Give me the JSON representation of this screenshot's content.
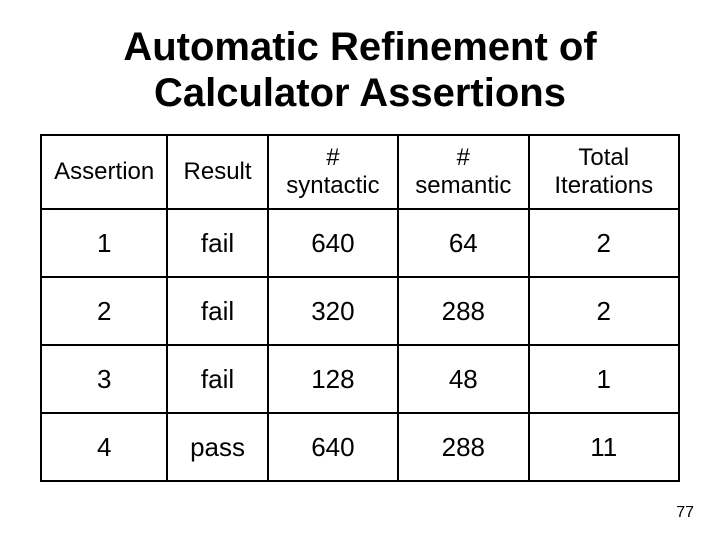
{
  "title": "Automatic Refinement of Calculator Assertions",
  "headers": {
    "c1": "Assertion",
    "c2": "Result",
    "c3a": "#",
    "c3b": "syntactic",
    "c4a": "#",
    "c4b": "semantic",
    "c5a": "Total",
    "c5b": "Iterations"
  },
  "rows": [
    {
      "assertion": "1",
      "result": "fail",
      "syntactic": "640",
      "semantic": "64",
      "iterations": "2"
    },
    {
      "assertion": "2",
      "result": "fail",
      "syntactic": "320",
      "semantic": "288",
      "iterations": "2"
    },
    {
      "assertion": "3",
      "result": "fail",
      "syntactic": "128",
      "semantic": "48",
      "iterations": "1"
    },
    {
      "assertion": "4",
      "result": "pass",
      "syntactic": "640",
      "semantic": "288",
      "iterations": "11"
    }
  ],
  "page_number": "77",
  "chart_data": {
    "type": "table",
    "title": "Automatic Refinement of Calculator Assertions",
    "columns": [
      "Assertion",
      "Result",
      "# syntactic",
      "# semantic",
      "Total Iterations"
    ],
    "rows": [
      [
        "1",
        "fail",
        640,
        64,
        2
      ],
      [
        "2",
        "fail",
        320,
        288,
        2
      ],
      [
        "3",
        "fail",
        128,
        48,
        1
      ],
      [
        "4",
        "pass",
        640,
        288,
        11
      ]
    ]
  }
}
